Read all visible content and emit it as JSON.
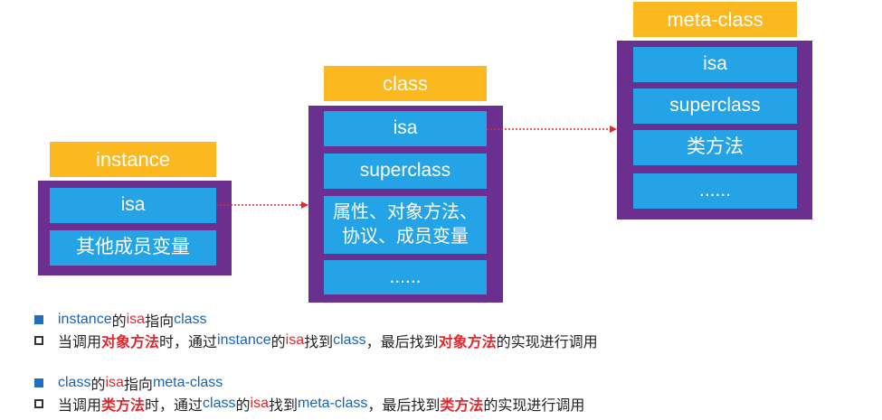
{
  "instance": {
    "title": "instance",
    "cells": [
      "isa",
      "其他成员变量"
    ]
  },
  "class": {
    "title": "class",
    "cells": [
      "isa",
      "superclass",
      "属性、对象方法、\n协议、成员变量",
      "......"
    ]
  },
  "meta_class": {
    "title": "meta-class",
    "cells": [
      "isa",
      "superclass",
      "类方法",
      "......"
    ]
  },
  "notes": {
    "n1": {
      "a": "instance",
      "b": "的",
      "c": "isa",
      "d": "指向",
      "e": "class"
    },
    "n2": {
      "a": "当调用",
      "b": "对象方法",
      "c": "时，通过",
      "d": "instance",
      "e": "的",
      "f": "isa",
      "g": "找到",
      "h": "class",
      "i": "，最后找到",
      "j": "对象方法",
      "k": "的实现进行调用"
    },
    "n3": {
      "a": "class",
      "b": "的",
      "c": "isa",
      "d": "指向",
      "e": "meta-class"
    },
    "n4": {
      "a": "当调用",
      "b": "类方法",
      "c": "时，通过",
      "d": "class",
      "e": "的",
      "f": "isa",
      "g": "找到",
      "h": "meta-class",
      "i": "，最后找到",
      "j": "类方法",
      "k": "的实现进行调用"
    }
  },
  "colors": {
    "title_bg": "#fbb81f",
    "box_bg": "#6a2f8f",
    "cell_bg": "#24a4e6",
    "arrow": "#e0282f",
    "keyword_blue": "#1a62b5",
    "keyword_red": "#e0282f"
  }
}
